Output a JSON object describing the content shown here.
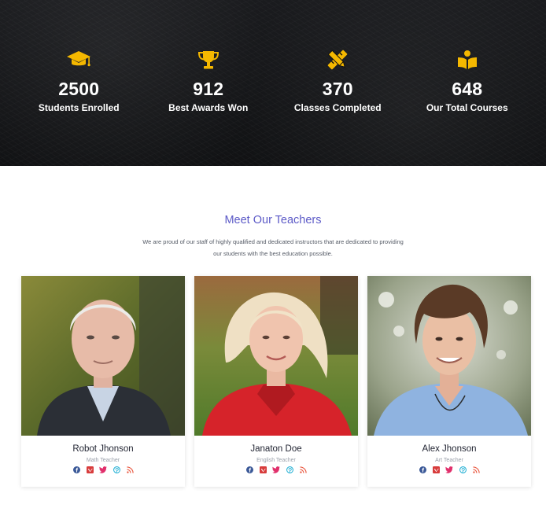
{
  "stats": {
    "items": [
      {
        "number": "2500",
        "label": "Students Enrolled",
        "icon": "graduation-cap-icon"
      },
      {
        "number": "912",
        "label": "Best Awards Won",
        "icon": "trophy-icon"
      },
      {
        "number": "370",
        "label": "Classes Completed",
        "icon": "pencil-ruler-icon"
      },
      {
        "number": "648",
        "label": "Our Total Courses",
        "icon": "open-book-icon"
      }
    ],
    "accent_color": "#f5b800"
  },
  "teachers": {
    "title": "Meet Our Teachers",
    "description": "We are proud of our staff of highly qualified and dedicated instructors that are dedicated to providing our students with the best education possible.",
    "cards": [
      {
        "name": "Robot Jhonson",
        "role": "Math Teacher"
      },
      {
        "name": "Janaton Doe",
        "role": "English Teacher"
      },
      {
        "name": "Alex Jhonson",
        "role": "Art Teacher"
      }
    ],
    "social_icons": [
      {
        "icon": "facebook-icon",
        "color": "#3b5998"
      },
      {
        "icon": "vimeo-icon",
        "color": "#d83c3c"
      },
      {
        "icon": "twitter-icon",
        "color": "#e1306c"
      },
      {
        "icon": "pinterest-icon",
        "color": "#2bb3d6"
      },
      {
        "icon": "rss-icon",
        "color": "#e9573f"
      }
    ]
  }
}
